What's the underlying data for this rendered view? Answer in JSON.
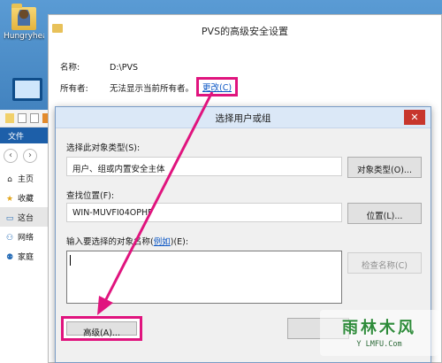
{
  "desktop": {
    "user_folder_label": "Hungryhea"
  },
  "explorer": {
    "file_menu": "文件",
    "nav_items": [
      {
        "icon": "home-icon",
        "glyph": "⌂",
        "label": "主页"
      },
      {
        "icon": "star-icon",
        "glyph": "★",
        "label": "收藏"
      },
      {
        "icon": "pc-icon",
        "glyph": "▭",
        "label": "这台"
      },
      {
        "icon": "network-icon",
        "glyph": "⚇",
        "label": "网络"
      },
      {
        "icon": "homegroup-icon",
        "glyph": "⚉",
        "label": "家庭"
      }
    ]
  },
  "advanced_security": {
    "title": "PVS的高级安全设置",
    "name_label": "名称:",
    "name_value": "D:\\PVS",
    "owner_label": "所有者:",
    "owner_value": "无法显示当前所有者。",
    "change_link": "更改(C)"
  },
  "select_dialog": {
    "title": "选择用户或组",
    "close_glyph": "✕",
    "object_type_label": "选择此对象类型(S):",
    "object_type_value": "用户、组或内置安全主体",
    "object_types_button": "对象类型(O)...",
    "location_label": "查找位置(F):",
    "location_value": "WIN-MUVFI04OPHF",
    "locations_button": "位置(L)...",
    "names_label_prefix": "输入要选择的对象名称(",
    "names_label_link": "例如",
    "names_label_suffix": ")(E):",
    "names_value": "",
    "check_names_button": "检查名称(C)",
    "advanced_button": "高级(A)..."
  },
  "annotation": {
    "highlight_color": "#e0147e"
  },
  "watermark": {
    "main": "雨林木风",
    "sub": "Y LMFU.Com"
  }
}
